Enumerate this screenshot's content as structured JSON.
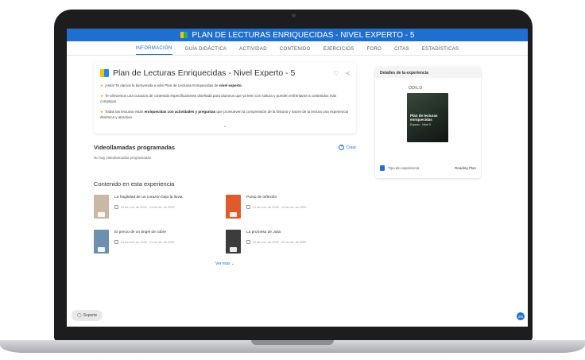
{
  "header": {
    "title": "PLAN DE LECTURAS ENRIQUECIDAS - NIVEL EXPERTO - 5"
  },
  "tabs": [
    {
      "label": "INFORMACIÓN"
    },
    {
      "label": "GUÍA DIDÁCTICA"
    },
    {
      "label": "ACTIVIDAD"
    },
    {
      "label": "CONTENIDO"
    },
    {
      "label": "EJERCICIOS"
    },
    {
      "label": "FORO"
    },
    {
      "label": "CITAS"
    },
    {
      "label": "ESTADÍSTICAS"
    }
  ],
  "main": {
    "title": "Plan de Lecturas Enriquecidas - Nivel Experto - 5",
    "intro": {
      "p1_a": "¡Hola! Te damos la bienvenida a este Plan de Lecturas Enriquecidas de ",
      "p1_b": "nivel experto.",
      "p2": "Te ofrecemos una curación de contenido específicamente diseñada para alumnos que ya leen con soltura y pueden enfrentarse a contenidos más complejos.",
      "p3_a": "Todas las lecturas están ",
      "p3_b": "enriquecidas con actividades y preguntas",
      "p3_c": " que promueven la comprensión de la historia y hacen de la lectura una experiencia dinámica y atractiva."
    },
    "videos": {
      "title": "Videollamadas programadas",
      "create_label": "Crear",
      "empty_text": "No hay videollamadas programadas"
    },
    "content": {
      "title": "Contenido en esta experiencia",
      "items": [
        {
          "title": "La fragilidad de un corazón bajo la lluvia",
          "meta": "01 de ene. de 2025 · 24 de dic. de 2099",
          "color": "#c9b8a4"
        },
        {
          "title": "Punto de inflexión",
          "meta": "01 de ene. de 2025 · 24 de dic. de 2099",
          "color": "#e05a2b"
        },
        {
          "title": "El precio de un ángel de cobre",
          "meta": "01 de ene. de 2025 · 24 de dic. de 2099",
          "color": "#6d8fb0"
        },
        {
          "title": "La promesa de Julia",
          "meta": "01 de ene. de 2025 · 24 de dic. de 2099",
          "color": "#3c3c3c"
        }
      ],
      "more_label": "Ver más"
    }
  },
  "side": {
    "header": "Detalles de la experiencia",
    "brand": "ODILO",
    "cover_title": "Plan de lecturas enriquecidas",
    "cover_subtitle": "Experto · Nivel 5",
    "type_label": "Tipo de experiencia",
    "type_value": "Reading Plan"
  },
  "support_label": "Soporte",
  "badge_label": "2/6",
  "colors": {
    "primary": "#1f6fd1"
  }
}
